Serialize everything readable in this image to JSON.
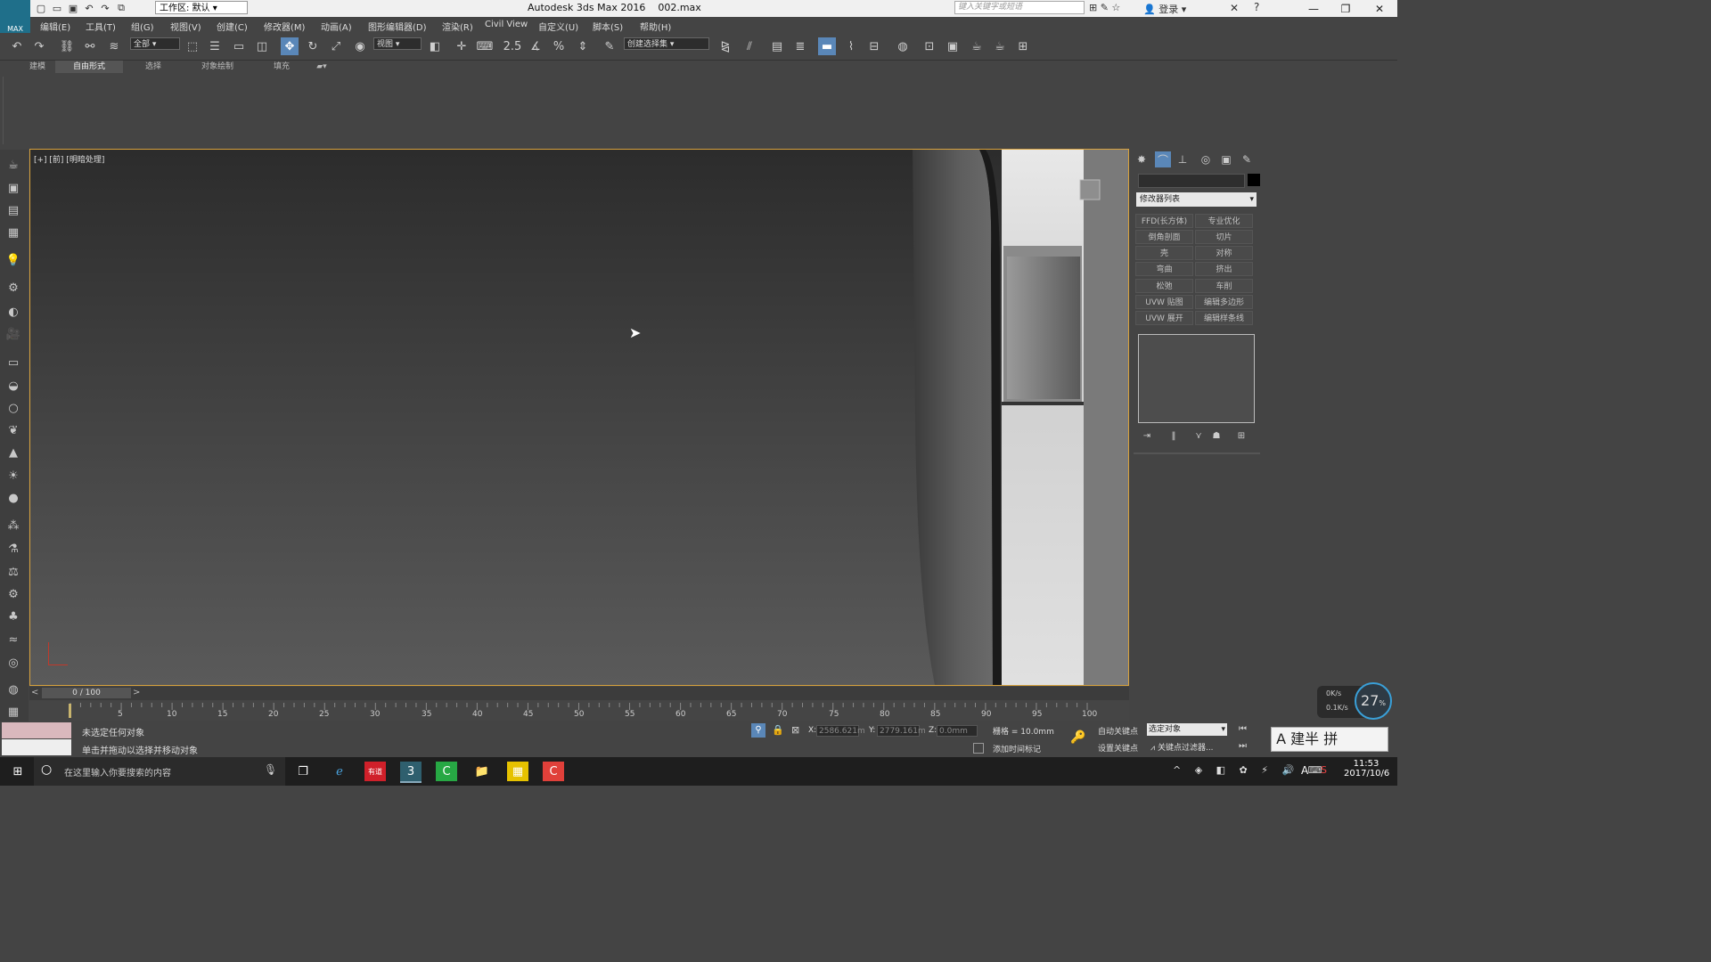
{
  "titlebar": {
    "workspace_prefix": "工作区:",
    "workspace": "默认",
    "app_title": "Autodesk 3ds Max 2016",
    "file": "002.max",
    "search_placeholder": "键入关键字或短语",
    "login": "登录",
    "icons": [
      "new-icon",
      "open-icon",
      "save-icon",
      "undo-icon",
      "redo-icon",
      "project-icon"
    ]
  },
  "menubar": {
    "logo": "MAX",
    "items": [
      "编辑(E)",
      "工具(T)",
      "组(G)",
      "视图(V)",
      "创建(C)",
      "修改器(M)",
      "动画(A)",
      "图形编辑器(D)",
      "渲染(R)",
      "Civil View",
      "自定义(U)",
      "脚本(S)",
      "帮助(H)"
    ]
  },
  "toolbar": {
    "selection_filter": "全部",
    "ref_coord": "视图",
    "named_selection": "创建选择集",
    "snap_label": "2.5"
  },
  "ribbon": {
    "tabs": [
      "建模",
      "自由形式",
      "选择",
      "对象绘制",
      "填充"
    ]
  },
  "viewport": {
    "label": "[+] [前] [明暗处理]"
  },
  "command_panel": {
    "modifier_list": "修改器列表",
    "buttons": [
      "FFD(长方体)",
      "专业优化",
      "倒角剖面",
      "切片",
      "壳",
      "对称",
      "弯曲",
      "挤出",
      "松弛",
      "车削",
      "UVW 贴图",
      "编辑多边形",
      "UVW 展开",
      "编辑样条线"
    ]
  },
  "timeline": {
    "frame": "0 / 100",
    "ticks": [
      "5",
      "10",
      "15",
      "20",
      "25",
      "30",
      "35",
      "40",
      "45",
      "50",
      "55",
      "60",
      "65",
      "70",
      "75",
      "80",
      "85",
      "90",
      "95",
      "100"
    ]
  },
  "status": {
    "message1": "未选定任何对象",
    "message2": "单击并拖动以选择并移动对象",
    "x_label": "X:",
    "x": "2586.621m",
    "y_label": "Y:",
    "y": "2779.161m",
    "z_label": "Z:",
    "z": "0.0mm",
    "grid": "栅格 = 10.0mm",
    "add_time_tag": "添加时间标记",
    "auto_key": "自动关键点",
    "set_key": "设置关键点",
    "selected": "选定对象",
    "key_filter": "关键点过滤器..."
  },
  "taskbar": {
    "search": "在这里输入你要搜索的内容",
    "time": "11:53",
    "date": "2017/10/6",
    "net_up": "0K/s",
    "net_down": "0.1K/s",
    "net_percent": "27",
    "ime_char": "A",
    "ime_panel": "建半 拼"
  }
}
